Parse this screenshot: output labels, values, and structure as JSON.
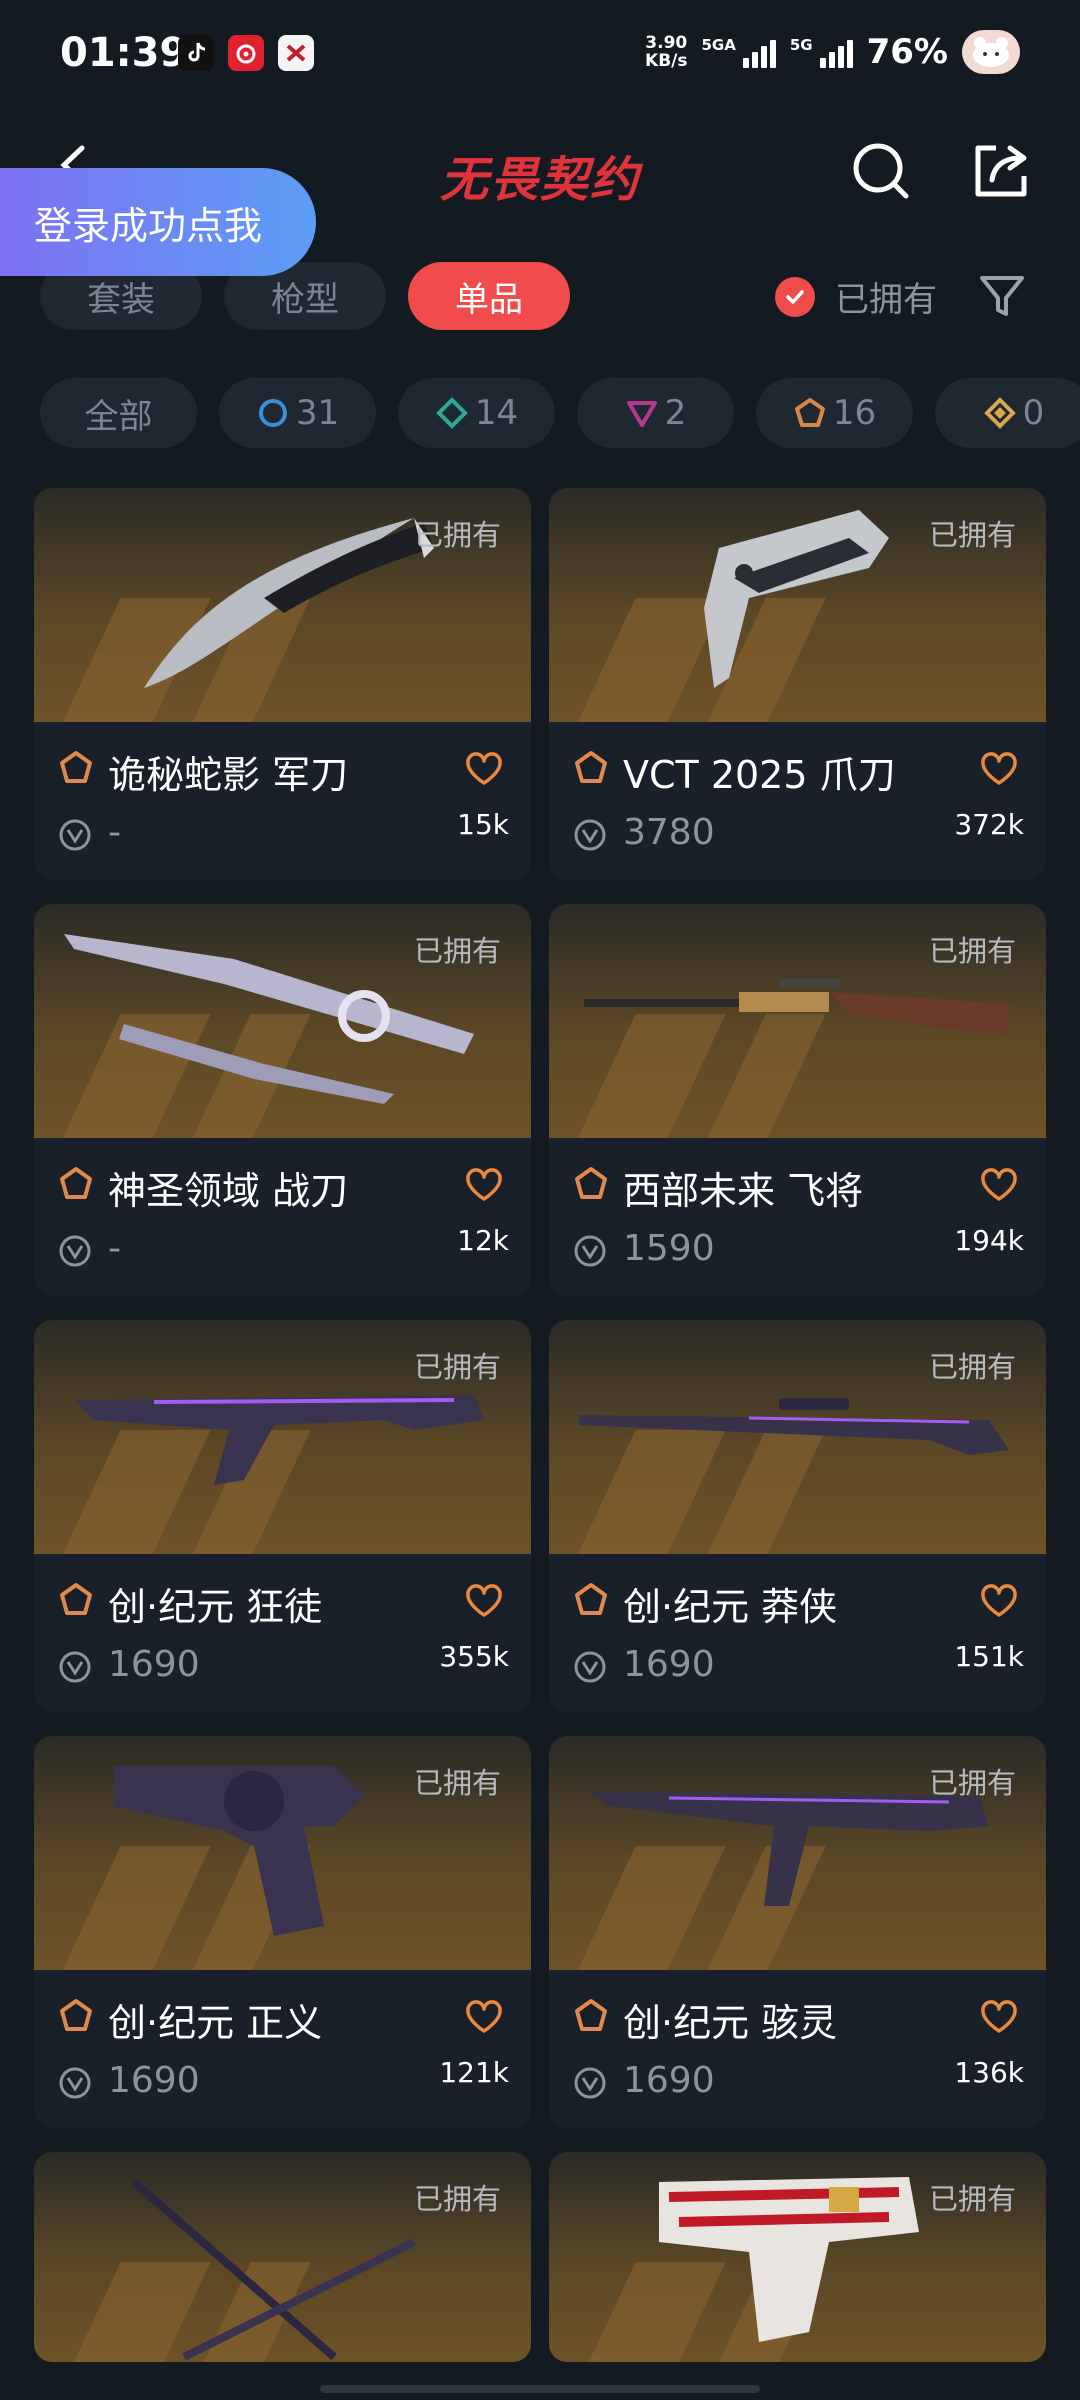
{
  "status_bar": {
    "time": "01:39",
    "net_speed_value": "3.90",
    "net_speed_unit": "KB/s",
    "sim1_label": "5GA",
    "sim2_label": "5G",
    "battery": "76%"
  },
  "header": {
    "title": "无畏契约"
  },
  "login_float": {
    "label": "登录成功点我"
  },
  "category_tabs": [
    {
      "label": "套装",
      "active": false
    },
    {
      "label": "枪型",
      "active": false
    },
    {
      "label": "单品",
      "active": true
    }
  ],
  "owned_filter": {
    "label": "已拥有",
    "checked": true
  },
  "rarity_filters": [
    {
      "label": "全部"
    },
    {
      "count": "31",
      "color": "#3a8fd8"
    },
    {
      "count": "14",
      "color": "#2fa79a"
    },
    {
      "count": "2",
      "color": "#b83a8c"
    },
    {
      "count": "16",
      "color": "#d8874a"
    },
    {
      "count": "0",
      "color": "#d8a84a"
    }
  ],
  "colors": {
    "accent": "#f04c4c",
    "rarity_orange": "#e08a4e",
    "heart": "#e8883e"
  },
  "items": [
    {
      "name": "诡秘蛇影 军刀",
      "price": "-",
      "likes": "15k",
      "owned": "已拥有"
    },
    {
      "name": "VCT 2025 爪刀",
      "price": "3780",
      "likes": "372k",
      "owned": "已拥有"
    },
    {
      "name": "神圣领域 战刀",
      "price": "-",
      "likes": "12k",
      "owned": "已拥有"
    },
    {
      "name": "西部未来 飞将",
      "price": "1590",
      "likes": "194k",
      "owned": "已拥有"
    },
    {
      "name": "创·纪元 狂徒",
      "price": "1690",
      "likes": "355k",
      "owned": "已拥有"
    },
    {
      "name": "创·纪元 莽侠",
      "price": "1690",
      "likes": "151k",
      "owned": "已拥有"
    },
    {
      "name": "创·纪元 正义",
      "price": "1690",
      "likes": "121k",
      "owned": "已拥有"
    },
    {
      "name": "创·纪元 骇灵",
      "price": "1690",
      "likes": "136k",
      "owned": "已拥有"
    },
    {
      "owned": "已拥有"
    },
    {
      "owned": "已拥有"
    }
  ]
}
